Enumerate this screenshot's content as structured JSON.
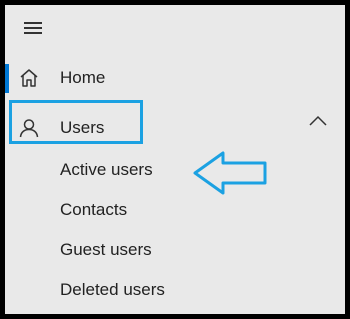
{
  "nav": {
    "items": [
      {
        "label": "Home",
        "icon": "home-icon"
      },
      {
        "label": "Users",
        "icon": "user-icon"
      }
    ],
    "users_submenu": [
      {
        "label": "Active users"
      },
      {
        "label": "Contacts"
      },
      {
        "label": "Guest users"
      },
      {
        "label": "Deleted users"
      }
    ]
  },
  "colors": {
    "active_indicator": "#0078d4",
    "annotation": "#1ba1e2",
    "background": "#e9e9e9"
  }
}
